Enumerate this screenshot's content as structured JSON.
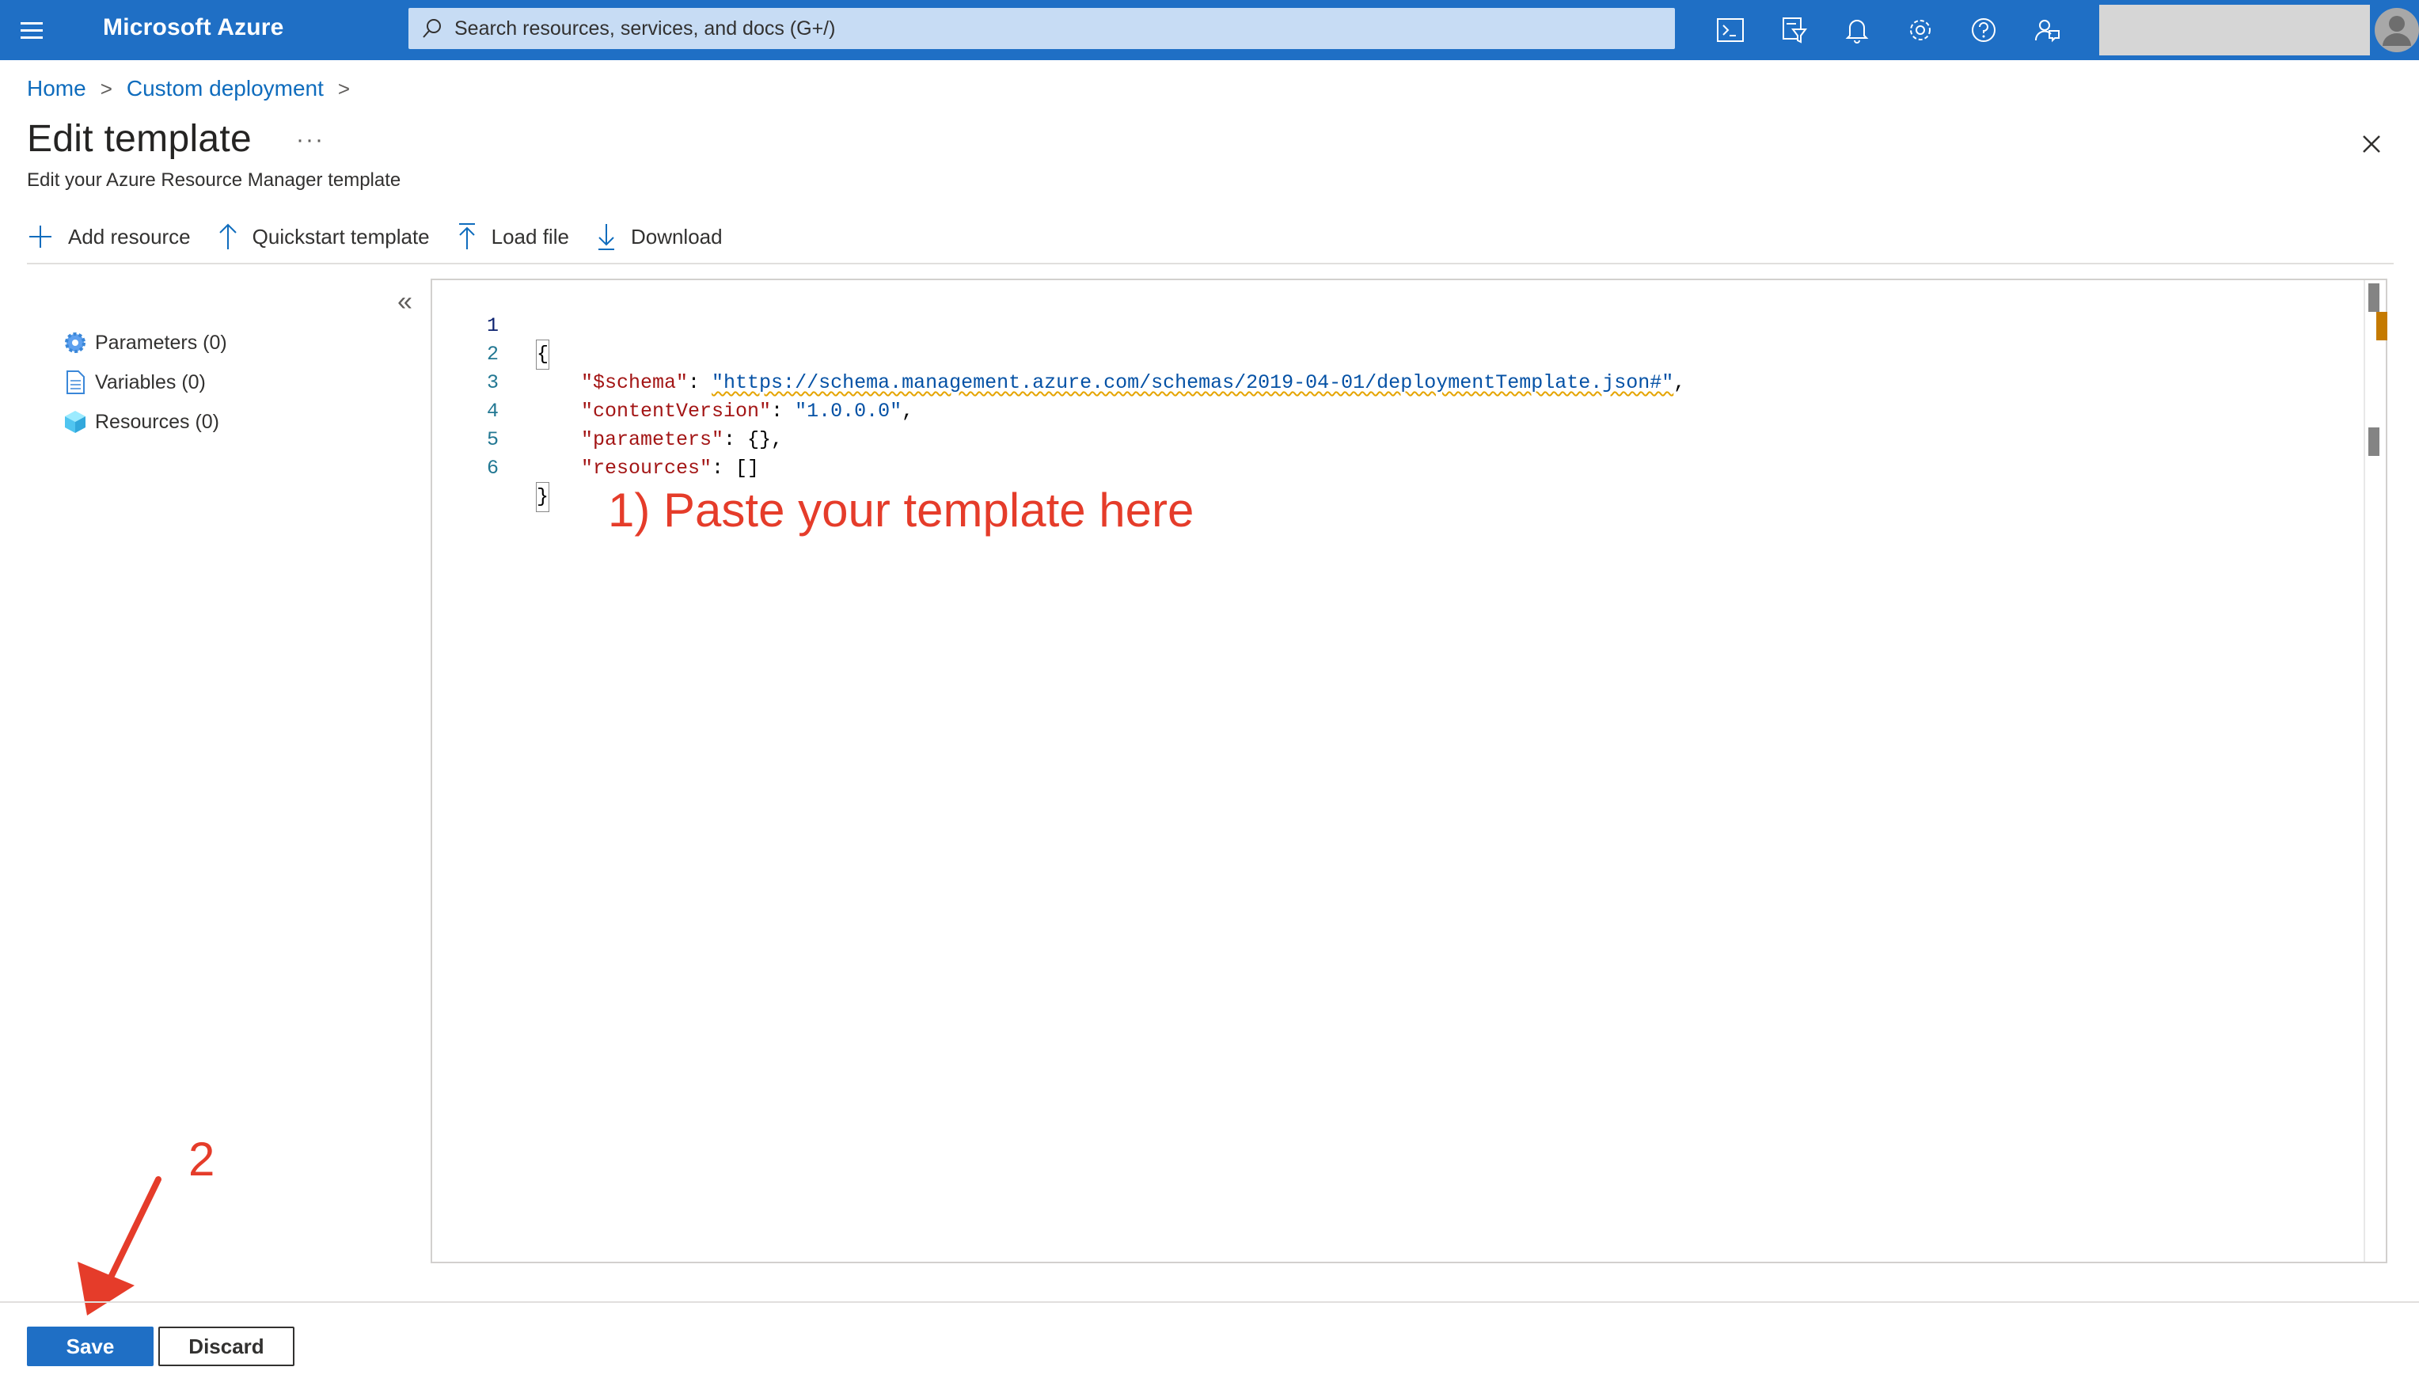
{
  "topbar": {
    "brand": "Microsoft Azure",
    "search_placeholder": "Search resources, services, and docs (G+/)",
    "icons": [
      "cloud-shell-icon",
      "directory-filter-icon",
      "notifications-icon",
      "settings-icon",
      "help-icon",
      "feedback-icon"
    ],
    "bar_color": "#1f6fc5"
  },
  "breadcrumb": {
    "items": [
      "Home",
      "Custom deployment"
    ],
    "separator": ">"
  },
  "page": {
    "title": "Edit template",
    "more": "···",
    "subtitle": "Edit your Azure Resource Manager template"
  },
  "toolbar": {
    "items": [
      {
        "label": "Add resource",
        "icon": "plus-icon"
      },
      {
        "label": "Quickstart template",
        "icon": "arrow-up-icon"
      },
      {
        "label": "Load file",
        "icon": "upload-icon"
      },
      {
        "label": "Download",
        "icon": "download-icon"
      }
    ]
  },
  "outline": {
    "collapse": "«",
    "items": [
      {
        "label": "Parameters (0)",
        "icon": "gear-icon"
      },
      {
        "label": "Variables (0)",
        "icon": "document-icon"
      },
      {
        "label": "Resources (0)",
        "icon": "cube-icon"
      }
    ]
  },
  "editor": {
    "line_numbers": [
      "1",
      "2",
      "3",
      "4",
      "5",
      "6"
    ],
    "lines": {
      "l1": "{",
      "l2_key": "\"$schema\"",
      "l2_sep": ": ",
      "l2_val": "\"https://schema.management.azure.com/schemas/2019-04-01/deploymentTemplate.json#\"",
      "l2_end": ",",
      "l3_key": "\"contentVersion\"",
      "l3_sep": ": ",
      "l3_val": "\"1.0.0.0\"",
      "l3_end": ",",
      "l4_key": "\"parameters\"",
      "l4_rest": ": {},",
      "l5_key": "\"resources\"",
      "l5_rest": ": []",
      "l6": "}"
    }
  },
  "annotations": {
    "paste": "1) Paste your template here",
    "step_two": "2",
    "color": "#e53c2a"
  },
  "footer": {
    "save": "Save",
    "discard": "Discard"
  }
}
